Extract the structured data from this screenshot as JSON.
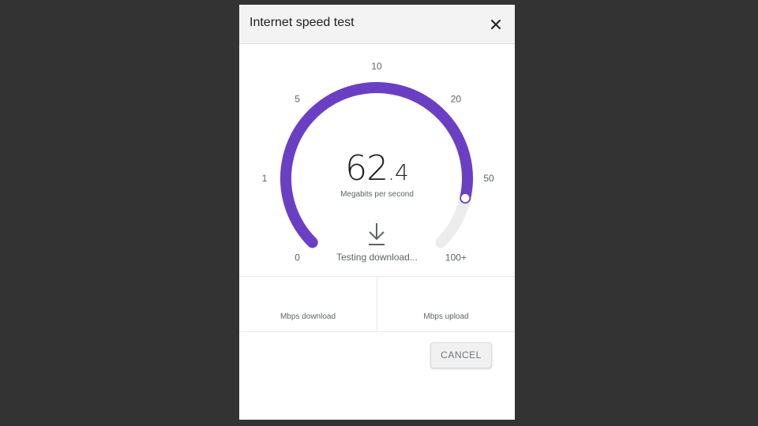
{
  "dialog": {
    "title": "Internet speed test",
    "close_icon": "close-icon"
  },
  "gauge": {
    "ticks": [
      {
        "label": "0",
        "angle": 225
      },
      {
        "label": "1",
        "angle": 270
      },
      {
        "label": "5",
        "angle": 315
      },
      {
        "label": "10",
        "angle": 0
      },
      {
        "label": "20",
        "angle": 45
      },
      {
        "label": "50",
        "angle": 90
      },
      {
        "label": "100+",
        "angle": 135
      }
    ],
    "progress_fraction": 0.88,
    "accent_color": "#6b3fc4",
    "track_color": "#ececec"
  },
  "speed": {
    "integer": "62",
    "decimal": ".4",
    "unit": "Megabits per second"
  },
  "status": {
    "icon": "download-icon",
    "text": "Testing download..."
  },
  "results": {
    "download_label": "Mbps download",
    "upload_label": "Mbps upload"
  },
  "actions": {
    "cancel_label": "CANCEL"
  }
}
